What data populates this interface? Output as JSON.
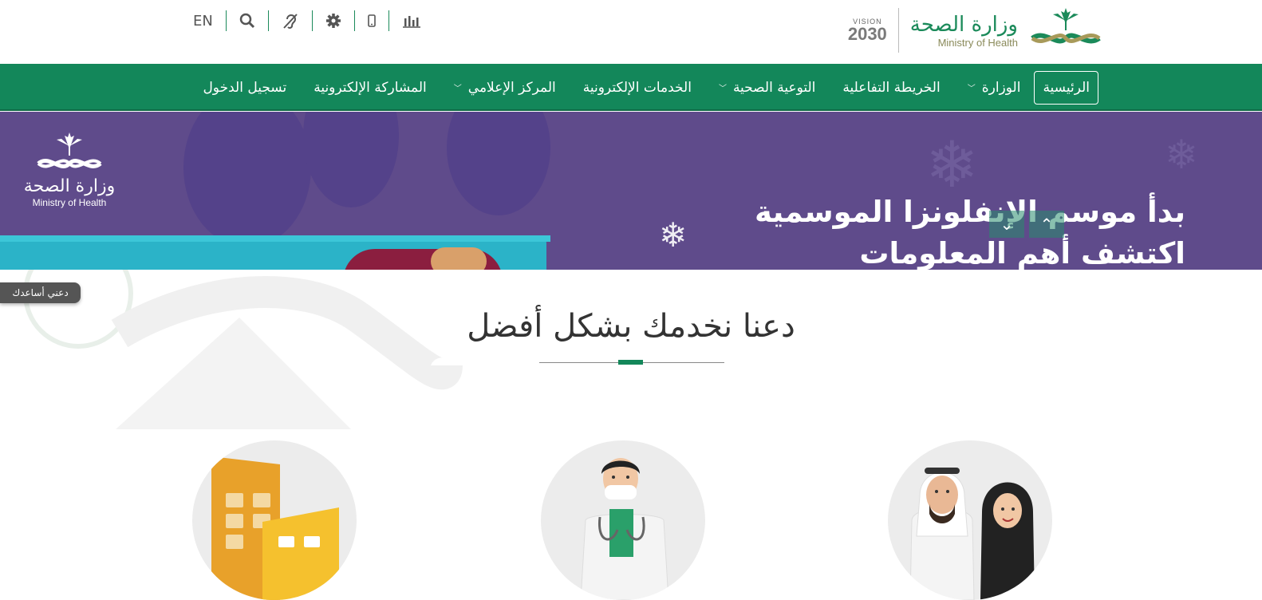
{
  "header": {
    "lang_switch": "EN",
    "icons": [
      "search-icon",
      "hearing-icon",
      "gear-icon",
      "mobile-icon",
      "stats-icon"
    ],
    "logo": {
      "arabic": "وزارة الصحة",
      "english": "Ministry of Health"
    },
    "vision": {
      "label": "VISION",
      "year": "2030"
    }
  },
  "nav": {
    "items": [
      {
        "label": "الرئيسية",
        "active": true,
        "dropdown": false
      },
      {
        "label": "الوزارة",
        "active": false,
        "dropdown": true
      },
      {
        "label": "الخريطة التفاعلية",
        "active": false,
        "dropdown": false
      },
      {
        "label": "التوعية الصحية",
        "active": false,
        "dropdown": true
      },
      {
        "label": "الخدمات الإلكترونية",
        "active": false,
        "dropdown": false
      },
      {
        "label": "المركز الإعلامي",
        "active": false,
        "dropdown": true
      },
      {
        "label": "المشاركة الإلكترونية",
        "active": false,
        "dropdown": false
      },
      {
        "label": "تسجيل الدخول",
        "active": false,
        "dropdown": false
      }
    ]
  },
  "banner": {
    "line1": "بدأ موسم الإنفلونزا الموسمية",
    "line2": "اكتشف أهم المعلومات",
    "logo_ar": "وزارة الصحة",
    "logo_en": "Ministry of Health"
  },
  "help_button": "دعني أساعدك",
  "section": {
    "title": "دعنا نخدمك بشكل أفضل"
  },
  "colors": {
    "primary": "#13875a",
    "banner": "#5f4b8b",
    "accent_gold": "#e8a12a"
  }
}
